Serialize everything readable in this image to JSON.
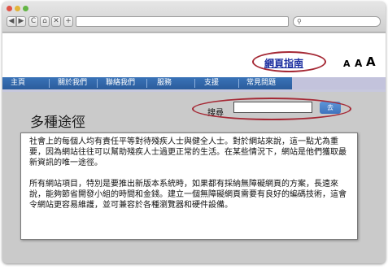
{
  "browser": {
    "url": "",
    "search_placeholder": "",
    "buttons": {
      "back": "◀",
      "forward": "▶",
      "reload": "C",
      "home": "⌂",
      "stop": "✕",
      "new_tab": "+"
    },
    "search_icon": "search-icon"
  },
  "header": {
    "guide_link": "網頁指南",
    "font_sizes": [
      "A",
      "A",
      "A"
    ]
  },
  "menu": {
    "items": [
      "主頁",
      "關於我們",
      "聯絡我們",
      "服務",
      "支援",
      "常見問題"
    ]
  },
  "main": {
    "title": "多種途徑",
    "search": {
      "label": "搜尋",
      "value": "",
      "button_label": "去"
    },
    "paragraphs": [
      "社會上的每個人均有責任平等對待殘疾人士與健全人士。對於網站來說，這一點尤為重要，因為網站往往可以幫助殘疾人士過更正常的生活。在某些情況下，網站是他們獲取最新資訊的唯一途徑。",
      "所有網站項目，特別是要推出新版本系統時，如果都有採納無障礙網頁的方案，長遠來說，能夠節省開發小組的時間和金錢。建立一個無障礙網頁需要有良好的編碼技術，這會令網站更容易維護，並可兼容於各種瀏覽器和硬件設備。"
    ]
  },
  "colors": {
    "menu_blue": "#3a73b8",
    "highlight_ring": "#a52935",
    "link": "#1d2fa0",
    "search_button": "#4a82c8"
  }
}
